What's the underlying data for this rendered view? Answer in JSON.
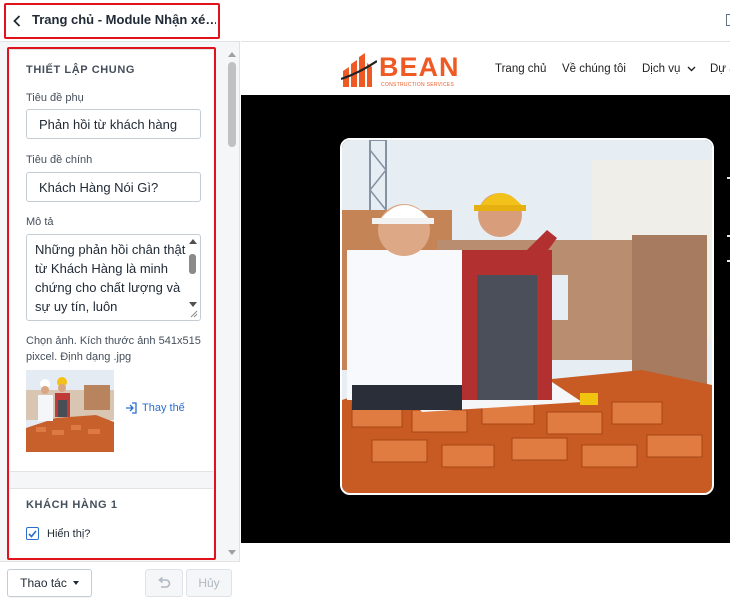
{
  "editor": {
    "header": {
      "title": "Trang chủ - Module Nhận xé…"
    },
    "general": {
      "section_title": "THIẾT LẬP CHUNG",
      "subtitle_label": "Tiêu đề phụ",
      "subtitle_value": "Phản hồi từ khách hàng",
      "main_title_label": "Tiêu đề chính",
      "main_title_value": "Khách Hàng Nói Gì?",
      "description_label": "Mô tả",
      "description_value": "Những phản hồi chân thật từ Khách Hàng là minh chứng cho chất lượng và sự uy tín, luôn",
      "image_hint": "Chọn ảnh. Kích thước ảnh 541x515 pixcel. Định dạng .jpg",
      "replace_label": "Thay thế"
    },
    "customer1": {
      "section_title": "KHÁCH HÀNG 1",
      "show_label": "Hiển thị?",
      "show_checked": true
    },
    "footer": {
      "actions_label": "Thao tác",
      "cancel_label": "Hủy"
    }
  },
  "preview": {
    "logo_text": "BEAN",
    "logo_subtext": "CONSTRUCTION SERVICES",
    "nav": [
      "Trang chủ",
      "Về chúng tôi",
      "Dịch vụ",
      "Dự á"
    ],
    "colors": {
      "brand": "#ef5a24",
      "highlight": "#e0121c",
      "hero_bg": "#000000"
    }
  }
}
